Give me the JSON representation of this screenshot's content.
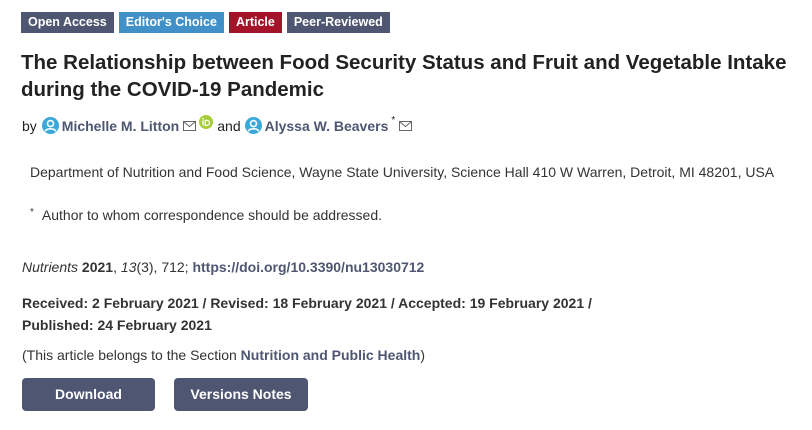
{
  "badges": [
    "Open Access",
    "Editor's Choice",
    "Article",
    "Peer-Reviewed"
  ],
  "title": "The Relationship between Food Security Status and Fruit and Vegetable Intake during the COVID-19 Pandemic",
  "authors": {
    "by": "by",
    "author1": "Michelle M. Litton",
    "and": "and",
    "author2": "Alyssa W. Beavers",
    "corresponding_mark": "*"
  },
  "affiliation": "Department of Nutrition and Food Science, Wayne State University, Science Hall 410 W Warren, Detroit, MI 48201, USA",
  "correspondence": {
    "mark": "*",
    "text": "Author to whom correspondence should be addressed."
  },
  "citation": {
    "journal": "Nutrients",
    "year": "2021",
    "volume": "13",
    "issue_pages": "(3), 712;",
    "doi": "https://doi.org/10.3390/nu13030712"
  },
  "dates": {
    "line1": "Received: 2 February 2021 / Revised: 18 February 2021 / Accepted: 19 February 2021 /",
    "line2": "Published: 24 February 2021"
  },
  "section": {
    "prefix": "(This article belongs to the Section",
    "name": "Nutrition and Public Health",
    "suffix": ")"
  },
  "buttons": {
    "download": "Download",
    "versions": "Versions Notes"
  },
  "colors": {
    "badge_dark": "#4f5671",
    "badge_blue": "#4290c8",
    "badge_red": "#a3142b",
    "person_icon": "#3aa8d8",
    "orcid": "#a6ce39"
  },
  "icons": [
    "person-icon",
    "mail-icon",
    "orcid-icon"
  ]
}
